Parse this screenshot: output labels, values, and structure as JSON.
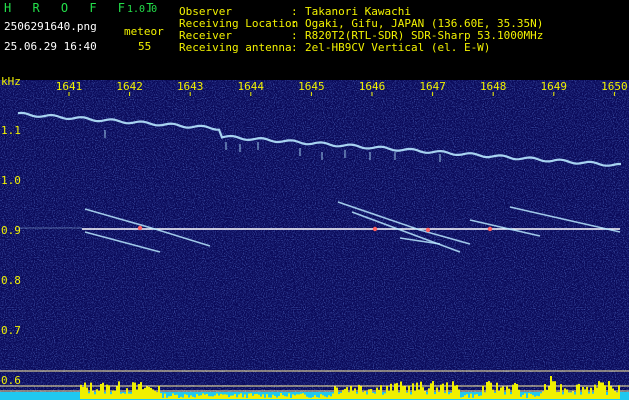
{
  "header": {
    "app_title": "H R O F F T",
    "version": "1.0.0",
    "filename": "2506291640.png",
    "meteor_label": "meteor",
    "datetime": "25.06.29 16:40",
    "meteor_count": "55"
  },
  "info": [
    {
      "key": "Observer",
      "sep": ":",
      "value": "Takanori Kawachi"
    },
    {
      "key": "Receiving Location",
      "sep": ":",
      "value": "Ogaki, Gifu, JAPAN (136.60E, 35.35N)"
    },
    {
      "key": "Receiver",
      "sep": ":",
      "value": "R820T2(RTL-SDR) SDR-Sharp 53.1000MHz"
    },
    {
      "key": "Receiving antenna",
      "sep": ":",
      "value": "2el-HB9CV Vertical (el. E-W)"
    }
  ],
  "spectrogram": {
    "unit_label": "kHz",
    "time_ticks": [
      "1641",
      "1642",
      "1643",
      "1644",
      "1645",
      "1646",
      "1647",
      "1648",
      "1649",
      "1650"
    ],
    "freq_ticks": [
      "1.1",
      "1.0",
      "0.9",
      "0.8",
      "0.7",
      "0.6"
    ],
    "colors": {
      "background": "#0a0a5a",
      "noise": "#1f3fb8",
      "axis_text": "#f2f200",
      "beacon_line": "#ffffff",
      "trace": "#b8e8ff",
      "trace_hot": "#ff6060",
      "meter_cyan": "#20c8f0",
      "meter_yellow": "#f0f000",
      "meter_lines": "#fff0a0"
    }
  }
}
